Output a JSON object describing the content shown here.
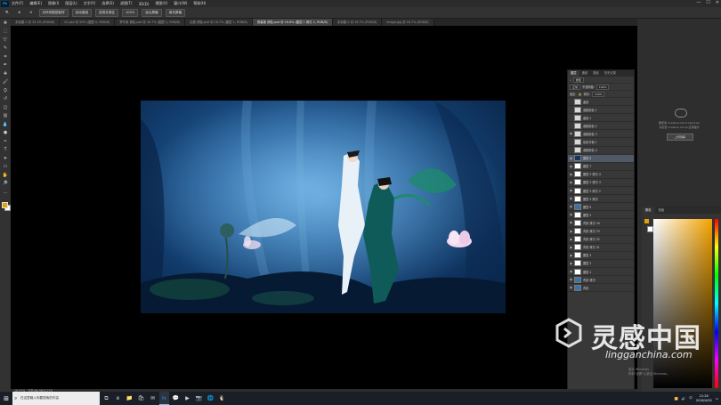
{
  "menu": {
    "app_icon": "Ps",
    "items": [
      "文件(F)",
      "编辑(E)",
      "图像(I)",
      "图层(L)",
      "文字(Y)",
      "选择(S)",
      "滤镜(T)",
      "3D(D)",
      "视图(V)",
      "窗口(W)",
      "帮助(H)"
    ],
    "window_controls": [
      "—",
      "☐",
      "✕"
    ]
  },
  "options": {
    "tool_icon": "quick-select-icon",
    "sample_all": "对所有图层取样",
    "enhance_edge": "自动增强",
    "refine": "选择并遮住",
    "zoom": "100%",
    "fit": "适合屏幕",
    "fill": "填充屏幕"
  },
  "tabs": [
    {
      "label": "未标题-1 @ 33.3% (RGB/8)",
      "active": false
    },
    {
      "label": "02.psd @ 50% (图层 0, RGB/8)",
      "active": false
    },
    {
      "label": "梦华录 调色.psd @ 16.7% (图层 1, RGB/8)",
      "active": false
    },
    {
      "label": "仙侠 调色.psd @ 16.7% (图层 1, RGB/8)",
      "active": false
    },
    {
      "label": "夜幕莲 调色.psd @ 16.6% (图层 1 拷贝 2, RGB/8)",
      "active": true
    },
    {
      "label": "未标题-2 @ 16.7% (RGB/8)",
      "active": false
    },
    {
      "label": "image.jpg @ 16.7% (RGB/8)",
      "active": false
    }
  ],
  "layers": {
    "tabs": [
      "图层",
      "通道",
      "路径",
      "历史记录"
    ],
    "filter": "类型",
    "blend": "正常",
    "opacity_label": "不透明度:",
    "opacity": "100%",
    "lock_label": "锁定:",
    "fill_label": "填充:",
    "fill": "100%",
    "items": [
      {
        "name": "曲线",
        "thumb": "adj",
        "selected": false,
        "visible": false
      },
      {
        "name": "选取颜色 1",
        "thumb": "adj",
        "selected": false,
        "visible": false
      },
      {
        "name": "曲线 1",
        "thumb": "adj",
        "selected": false,
        "visible": false
      },
      {
        "name": "选取颜色 2",
        "thumb": "adj",
        "selected": false,
        "visible": false
      },
      {
        "name": "选取颜色 3",
        "thumb": "adj",
        "selected": false,
        "visible": true
      },
      {
        "name": "色彩平衡 1",
        "thumb": "adj",
        "selected": false,
        "visible": false
      },
      {
        "name": "选取颜色 4",
        "thumb": "adj",
        "selected": false,
        "visible": false
      },
      {
        "name": "图层 8",
        "thumb": "dark",
        "selected": true,
        "visible": true
      },
      {
        "name": "图层 7",
        "thumb": "plain",
        "selected": false,
        "visible": true
      },
      {
        "name": "图层 5 拷贝 4",
        "thumb": "plain",
        "selected": false,
        "visible": true
      },
      {
        "name": "图层 5 拷贝 3",
        "thumb": "plain",
        "selected": false,
        "visible": true
      },
      {
        "name": "图层 5 拷贝 2",
        "thumb": "plain",
        "selected": false,
        "visible": true
      },
      {
        "name": "图层 5 拷贝",
        "thumb": "plain",
        "selected": false,
        "visible": true
      },
      {
        "name": "图层 6",
        "thumb": "photo",
        "selected": false,
        "visible": true
      },
      {
        "name": "图层 5",
        "thumb": "plain",
        "selected": false,
        "visible": true
      },
      {
        "name": "背景 拷贝 34",
        "thumb": "plain",
        "selected": false,
        "visible": true
      },
      {
        "name": "背景 拷贝 33",
        "thumb": "plain",
        "selected": false,
        "visible": true
      },
      {
        "name": "背景 拷贝 32",
        "thumb": "plain",
        "selected": false,
        "visible": true
      },
      {
        "name": "背景 拷贝 31",
        "thumb": "plain",
        "selected": false,
        "visible": true
      },
      {
        "name": "图层 4",
        "thumb": "plain",
        "selected": false,
        "visible": true
      },
      {
        "name": "图层 3",
        "thumb": "plain",
        "selected": false,
        "visible": true
      },
      {
        "name": "图层 2",
        "thumb": "plain",
        "selected": false,
        "visible": true
      },
      {
        "name": "背景 拷贝",
        "thumb": "photo",
        "selected": false,
        "visible": true
      },
      {
        "name": "背景",
        "thumb": "photo",
        "selected": false,
        "visible": true
      }
    ]
  },
  "color_panel": {
    "tabs": [
      "颜色",
      "色板"
    ],
    "fg_color": "#e6a300",
    "bg_color": "#ffffff",
    "base_hue": "#f4a300"
  },
  "cc_panel": {
    "line1": "要使用 Creative Cloud Libraries",
    "line2": "请安装 Creative Cloud 应用程序",
    "button": "上传到库"
  },
  "status": {
    "zoom": "16.57%",
    "doc": "文档:86.9M/2.27G"
  },
  "taskbar": {
    "search_placeholder": "在这里输入你要搜索的内容",
    "time": "21:26",
    "date": "2018/4/30",
    "lang": "中",
    "icons": [
      "task-view-icon",
      "edge-icon",
      "folder-icon",
      "store-icon",
      "mail-icon",
      "photoshop-icon",
      "wechat-icon",
      "media-icon",
      "camera-icon",
      "network-icon",
      "qq-icon"
    ]
  },
  "activation": {
    "line1": "激活 Windows",
    "line2": "转到\"设置\"以激活 Windows。"
  },
  "watermark": {
    "cn": "灵感中国",
    "en": "lingganchina.com"
  }
}
